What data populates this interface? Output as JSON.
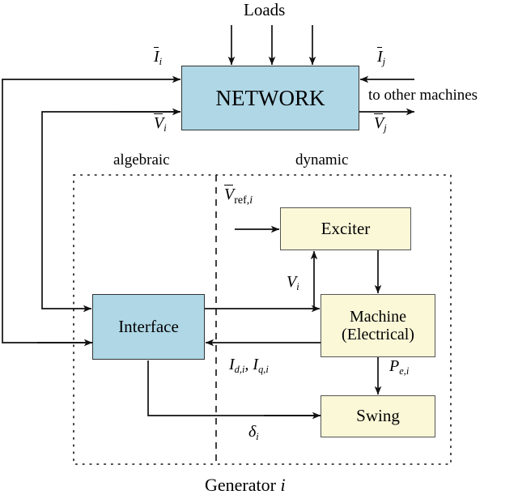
{
  "diagram": {
    "title_caption": "Generator i",
    "region_labels": {
      "left": "algebraic",
      "right": "dynamic"
    },
    "top_label": "Loads",
    "side_note": "to other machines",
    "nodes": {
      "network": {
        "label": "NETWORK",
        "fill": "#afd7e6",
        "stroke": "#333333"
      },
      "interface": {
        "label": "Interface",
        "fill": "#afd7e6",
        "stroke": "#333333"
      },
      "exciter": {
        "label": "Exciter",
        "fill": "#fbf8d8",
        "stroke": "#555555"
      },
      "machine": {
        "label_line1": "Machine",
        "label_line2": "(Electrical)",
        "fill": "#fbf8d8",
        "stroke": "#555555"
      },
      "swing": {
        "label": "Swing",
        "fill": "#fbf8d8",
        "stroke": "#555555"
      }
    },
    "signals": {
      "i_i": {
        "base": "I",
        "sub": "i",
        "overbar": true
      },
      "v_i": {
        "base": "V",
        "sub": "i",
        "overbar": true
      },
      "i_j": {
        "base": "I",
        "sub": "j",
        "overbar": true
      },
      "v_j": {
        "base": "V",
        "sub": "j",
        "overbar": true
      },
      "v_ref": {
        "base": "V",
        "sub": "ref,i",
        "overbar": true
      },
      "v_term": {
        "base": "V",
        "sub": "i",
        "overbar": false
      },
      "i_dq": {
        "text": "I",
        "sub1": "d,i",
        "sep": ", ",
        "text2": "I",
        "sub2": "q,i"
      },
      "p_e": {
        "base": "P",
        "sub": "e,i",
        "overbar": false
      },
      "delta": {
        "base": "δ",
        "sub": "i",
        "overbar": false
      }
    }
  }
}
